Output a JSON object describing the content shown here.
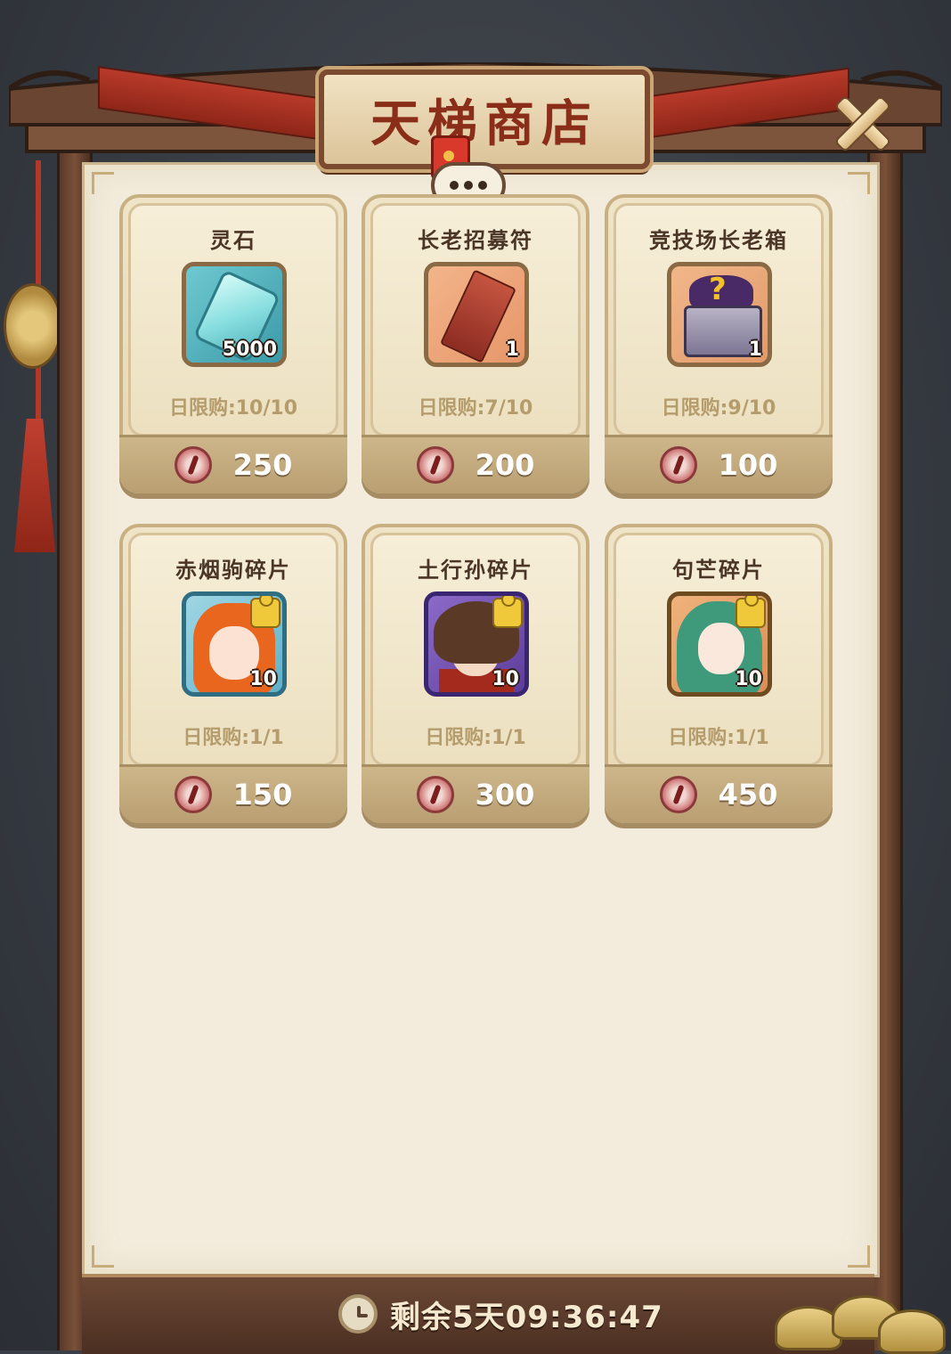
{
  "shop": {
    "title": "天梯商店",
    "timer": "剩余5天09:36:47"
  },
  "items": [
    {
      "name": "灵石",
      "qty": "5000",
      "limit": "日限购:10/10",
      "price": "250",
      "icon": "spirit-stone-icon"
    },
    {
      "name": "长老招募符",
      "qty": "1",
      "limit": "日限购:7/10",
      "price": "200",
      "icon": "elder-talisman-icon"
    },
    {
      "name": "竞技场长老箱",
      "qty": "1",
      "limit": "日限购:9/10",
      "price": "100",
      "icon": "arena-chest-icon"
    },
    {
      "name": "赤烟驹碎片",
      "qty": "10",
      "limit": "日限购:1/1",
      "price": "150",
      "icon": "hero-portrait-icon"
    },
    {
      "name": "土行孙碎片",
      "qty": "10",
      "limit": "日限购:1/1",
      "price": "300",
      "icon": "hero-portrait-icon"
    },
    {
      "name": "句芒碎片",
      "qty": "10",
      "limit": "日限购:1/1",
      "price": "450",
      "icon": "hero-portrait-icon"
    }
  ],
  "colors": {
    "title_text": "#8a2e1a",
    "parchment": "#f3ecdc",
    "card": "#efe4c7",
    "limit_text": "#b59c6c"
  }
}
